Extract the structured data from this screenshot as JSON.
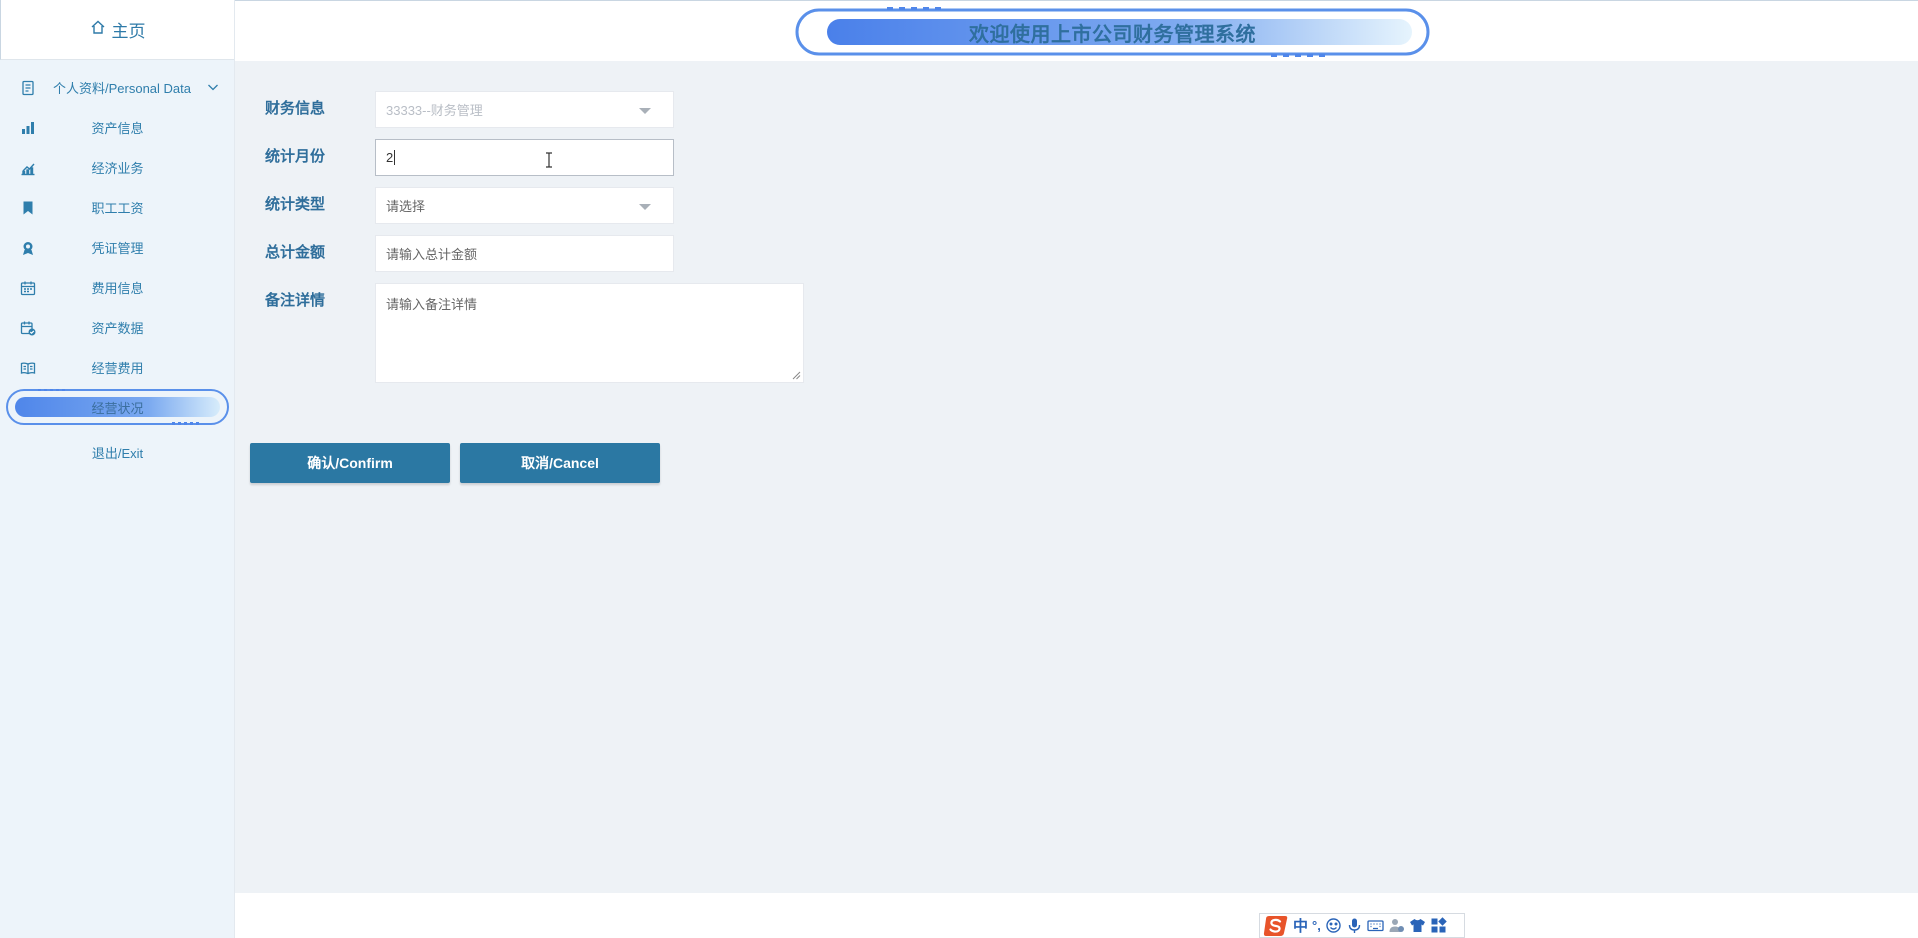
{
  "sidebar": {
    "home_label": "主页",
    "items": [
      {
        "label": "个人资料/Personal Data",
        "icon": "document-icon"
      },
      {
        "label": "资产信息",
        "icon": "asset-chart-icon"
      },
      {
        "label": "经济业务",
        "icon": "trend-chart-icon"
      },
      {
        "label": "职工工资",
        "icon": "bookmark-icon"
      },
      {
        "label": "凭证管理",
        "icon": "badge-icon"
      },
      {
        "label": "费用信息",
        "icon": "calendar-icon"
      },
      {
        "label": "资产数据",
        "icon": "calendar-check-icon"
      },
      {
        "label": "经营费用",
        "icon": "book-icon"
      },
      {
        "label": "经营状况",
        "icon": "",
        "active": true
      }
    ],
    "exit_label": "退出/Exit"
  },
  "header": {
    "title": "欢迎使用上市公司财务管理系统"
  },
  "form": {
    "finance_info": {
      "label": "财务信息",
      "value": "33333--财务管理"
    },
    "month": {
      "label": "统计月份",
      "value": "2"
    },
    "stat_type": {
      "label": "统计类型",
      "placeholder": "请选择"
    },
    "total_amount": {
      "label": "总计金额",
      "placeholder": "请输入总计金额"
    },
    "remark": {
      "label": "备注详情",
      "placeholder": "请输入备注详情"
    }
  },
  "buttons": {
    "confirm": "确认/Confirm",
    "cancel": "取消/Cancel"
  },
  "ime": {
    "mode": "中",
    "punct": "°,"
  },
  "colors": {
    "accent": "#2b78a3",
    "label": "#2f6e9b",
    "sidebar_bg": "#edf4fa",
    "main_bg": "#eef2f6",
    "pill": "#5b8fe8"
  }
}
